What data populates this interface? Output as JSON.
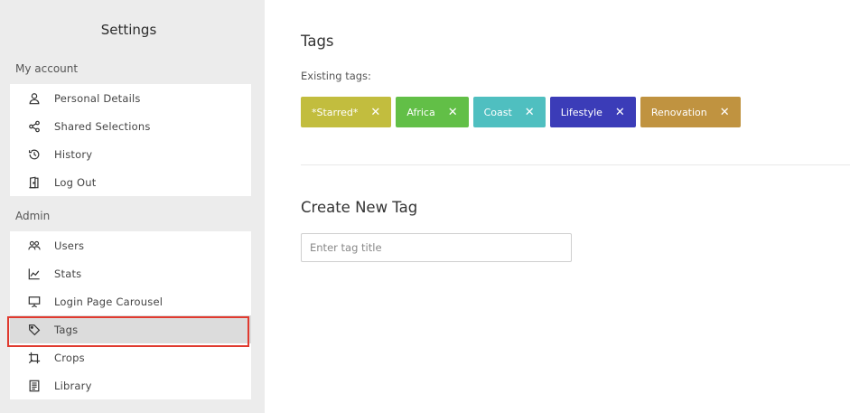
{
  "sidebar": {
    "title": "Settings",
    "sections": [
      {
        "label": "My account",
        "items": [
          {
            "label": "Personal Details",
            "icon": "person-icon"
          },
          {
            "label": "Shared Selections",
            "icon": "share-icon"
          },
          {
            "label": "History",
            "icon": "history-icon"
          },
          {
            "label": "Log Out",
            "icon": "logout-door-icon"
          }
        ]
      },
      {
        "label": "Admin",
        "items": [
          {
            "label": "Users",
            "icon": "users-icon"
          },
          {
            "label": "Stats",
            "icon": "stats-chart-icon"
          },
          {
            "label": "Login Page Carousel",
            "icon": "presentation-icon"
          },
          {
            "label": "Tags",
            "icon": "tag-icon",
            "active": true
          },
          {
            "label": "Crops",
            "icon": "crop-icon"
          },
          {
            "label": "Library",
            "icon": "library-icon"
          }
        ]
      }
    ]
  },
  "main": {
    "title": "Tags",
    "existing_label": "Existing tags:",
    "tags": [
      {
        "label": "*Starred*",
        "color": "#c2bd3e"
      },
      {
        "label": "Africa",
        "color": "#62bf47"
      },
      {
        "label": "Coast",
        "color": "#4fbfc0"
      },
      {
        "label": "Lifestyle",
        "color": "#3b3cb8"
      },
      {
        "label": "Renovation",
        "color": "#c09340"
      }
    ],
    "remove_glyph": "✕",
    "create_title": "Create New Tag",
    "input": {
      "value": "",
      "placeholder": "Enter tag title"
    }
  }
}
